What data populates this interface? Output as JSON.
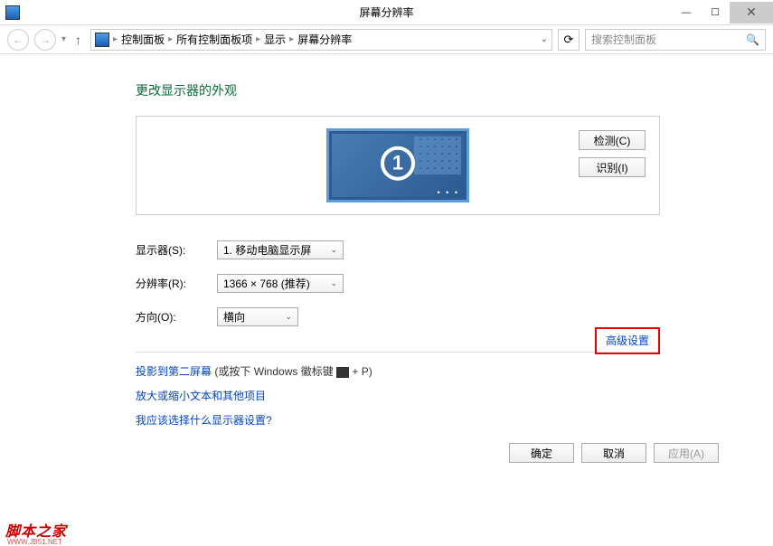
{
  "window": {
    "title": "屏幕分辨率"
  },
  "nav": {
    "breadcrumb": [
      "控制面板",
      "所有控制面板项",
      "显示",
      "屏幕分辨率"
    ],
    "search_placeholder": "搜索控制面板"
  },
  "heading": "更改显示器的外观",
  "preview": {
    "monitor_number": "1",
    "detect_label": "检测(C)",
    "identify_label": "识别(I)"
  },
  "form": {
    "display_label": "显示器(S):",
    "display_value": "1. 移动电脑显示屏",
    "resolution_label": "分辨率(R):",
    "resolution_value": "1366 × 768 (推荐)",
    "orientation_label": "方向(O):",
    "orientation_value": "横向"
  },
  "advanced_link": "高级设置",
  "links": {
    "project_pre": "投影到第二屏幕",
    "project_post": " (或按下 Windows 徽标键",
    "project_key": " + P)",
    "textsize": "放大或缩小文本和其他项目",
    "which": "我应该选择什么显示器设置?"
  },
  "buttons": {
    "ok": "确定",
    "cancel": "取消",
    "apply": "应用(A)"
  },
  "watermark": {
    "main": "脚本之家",
    "sub": "WWW.JB51.NET"
  }
}
